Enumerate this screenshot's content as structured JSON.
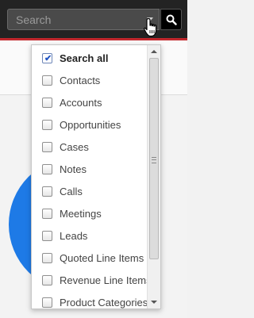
{
  "search": {
    "placeholder": "Search"
  },
  "icons": {
    "search_button": "magnifier-icon",
    "dropdown": "caret-down-icon",
    "cursor": "hand-pointer-icon"
  },
  "colors": {
    "topbar": "#232323",
    "accent_line": "#c1272d",
    "circle": "#1e7ae6"
  },
  "modules": {
    "items": [
      {
        "label": "Search all",
        "checked": true
      },
      {
        "label": "Contacts",
        "checked": false
      },
      {
        "label": "Accounts",
        "checked": false
      },
      {
        "label": "Opportunities",
        "checked": false
      },
      {
        "label": "Cases",
        "checked": false
      },
      {
        "label": "Notes",
        "checked": false
      },
      {
        "label": "Calls",
        "checked": false
      },
      {
        "label": "Meetings",
        "checked": false
      },
      {
        "label": "Leads",
        "checked": false
      },
      {
        "label": "Quoted Line Items",
        "checked": false
      },
      {
        "label": "Revenue Line Items",
        "checked": false
      },
      {
        "label": "Product Categories",
        "checked": false
      }
    ]
  }
}
